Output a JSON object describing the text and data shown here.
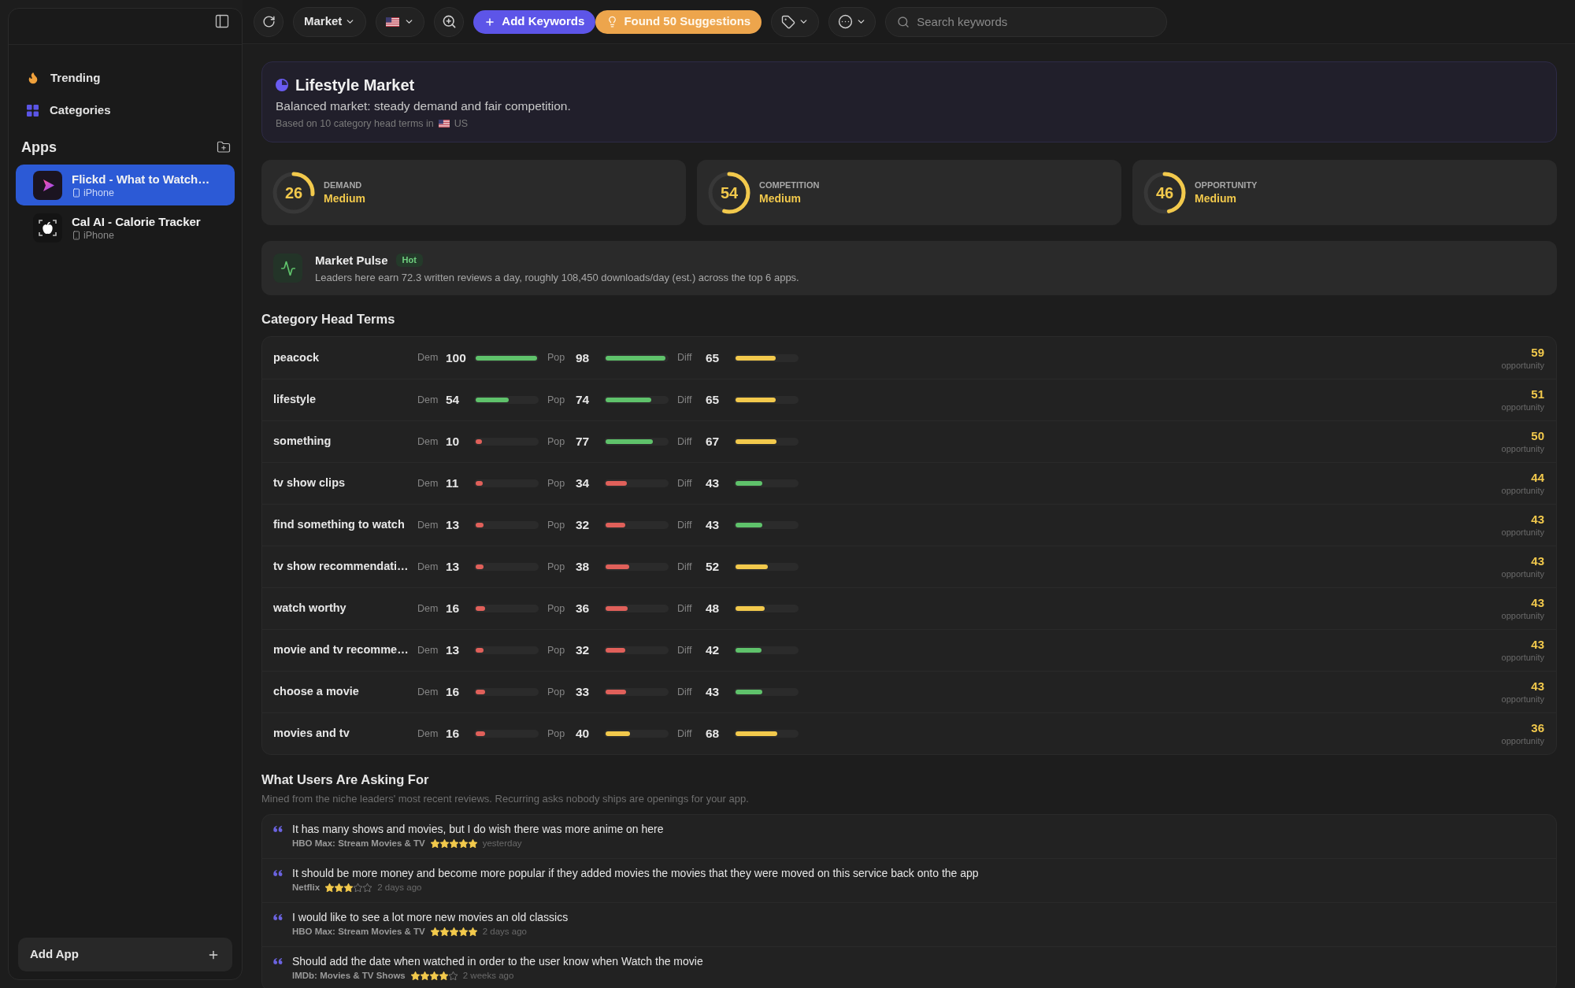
{
  "sidebar": {
    "nav": [
      {
        "label": "Trending"
      },
      {
        "label": "Categories"
      }
    ],
    "apps_heading": "Apps",
    "apps": [
      {
        "name": "Flickd - What to Watch…",
        "platform": "iPhone",
        "selected": true
      },
      {
        "name": "Cal AI - Calorie Tracker",
        "platform": "iPhone",
        "selected": false
      }
    ],
    "add_app": "Add App"
  },
  "toolbar": {
    "market_menu": "Market",
    "add_keywords": "Add Keywords",
    "suggestions": "Found 50 Suggestions",
    "search": {
      "placeholder": "Search keywords"
    }
  },
  "market": {
    "title": "Lifestyle Market",
    "summary": "Balanced market: steady demand and fair competition.",
    "basis": "Based on 10 category head terms in",
    "country": "US"
  },
  "metrics": [
    {
      "label": "DEMAND",
      "value": "26",
      "rating": "Medium",
      "level": 0.26
    },
    {
      "label": "COMPETITION",
      "value": "54",
      "rating": "Medium",
      "level": 0.54
    },
    {
      "label": "OPPORTUNITY",
      "value": "46",
      "rating": "Medium",
      "level": 0.46
    }
  ],
  "pulse": {
    "title": "Market Pulse",
    "badge": "Hot",
    "text": "Leaders here earn 72.3 written reviews a day, roughly 108,450 downloads/day (est.) across the top 6 apps."
  },
  "head_terms": {
    "title": "Category Head Terms",
    "rows": [
      {
        "term": "peacock",
        "scores": [
          {
            "label": "Dem",
            "value": "100",
            "level": 1.0,
            "color": "#5fc26b"
          },
          {
            "label": "Pop",
            "value": "98",
            "level": 0.98,
            "color": "#5fc26b"
          },
          {
            "label": "Diff",
            "value": "65",
            "level": 0.65,
            "color": "#f2c94c"
          }
        ],
        "opportunity": "59",
        "opportunity_label": "opportunity"
      },
      {
        "term": "lifestyle",
        "scores": [
          {
            "label": "Dem",
            "value": "54",
            "level": 0.54,
            "color": "#5fc26b"
          },
          {
            "label": "Pop",
            "value": "74",
            "level": 0.74,
            "color": "#5fc26b"
          },
          {
            "label": "Diff",
            "value": "65",
            "level": 0.65,
            "color": "#f2c94c"
          }
        ],
        "opportunity": "51",
        "opportunity_label": "opportunity"
      },
      {
        "term": "something",
        "scores": [
          {
            "label": "Dem",
            "value": "10",
            "level": 0.1,
            "color": "#e0605a"
          },
          {
            "label": "Pop",
            "value": "77",
            "level": 0.77,
            "color": "#5fc26b"
          },
          {
            "label": "Diff",
            "value": "67",
            "level": 0.67,
            "color": "#f2c94c"
          }
        ],
        "opportunity": "50",
        "opportunity_label": "opportunity"
      },
      {
        "term": "tv show clips",
        "scores": [
          {
            "label": "Dem",
            "value": "11",
            "level": 0.11,
            "color": "#e0605a"
          },
          {
            "label": "Pop",
            "value": "34",
            "level": 0.34,
            "color": "#e0605a"
          },
          {
            "label": "Diff",
            "value": "43",
            "level": 0.43,
            "color": "#5fc26b"
          }
        ],
        "opportunity": "44",
        "opportunity_label": "opportunity"
      },
      {
        "term": "find something to watch",
        "scores": [
          {
            "label": "Dem",
            "value": "13",
            "level": 0.13,
            "color": "#e0605a"
          },
          {
            "label": "Pop",
            "value": "32",
            "level": 0.32,
            "color": "#e0605a"
          },
          {
            "label": "Diff",
            "value": "43",
            "level": 0.43,
            "color": "#5fc26b"
          }
        ],
        "opportunity": "43",
        "opportunity_label": "opportunity"
      },
      {
        "term": "tv show recommendati…",
        "scores": [
          {
            "label": "Dem",
            "value": "13",
            "level": 0.13,
            "color": "#e0605a"
          },
          {
            "label": "Pop",
            "value": "38",
            "level": 0.38,
            "color": "#e0605a"
          },
          {
            "label": "Diff",
            "value": "52",
            "level": 0.52,
            "color": "#f2c94c"
          }
        ],
        "opportunity": "43",
        "opportunity_label": "opportunity"
      },
      {
        "term": "watch worthy",
        "scores": [
          {
            "label": "Dem",
            "value": "16",
            "level": 0.16,
            "color": "#e0605a"
          },
          {
            "label": "Pop",
            "value": "36",
            "level": 0.36,
            "color": "#e0605a"
          },
          {
            "label": "Diff",
            "value": "48",
            "level": 0.48,
            "color": "#f2c94c"
          }
        ],
        "opportunity": "43",
        "opportunity_label": "opportunity"
      },
      {
        "term": "movie and tv recomme…",
        "scores": [
          {
            "label": "Dem",
            "value": "13",
            "level": 0.13,
            "color": "#e0605a"
          },
          {
            "label": "Pop",
            "value": "32",
            "level": 0.32,
            "color": "#e0605a"
          },
          {
            "label": "Diff",
            "value": "42",
            "level": 0.42,
            "color": "#5fc26b"
          }
        ],
        "opportunity": "43",
        "opportunity_label": "opportunity"
      },
      {
        "term": "choose a movie",
        "scores": [
          {
            "label": "Dem",
            "value": "16",
            "level": 0.16,
            "color": "#e0605a"
          },
          {
            "label": "Pop",
            "value": "33",
            "level": 0.33,
            "color": "#e0605a"
          },
          {
            "label": "Diff",
            "value": "43",
            "level": 0.43,
            "color": "#5fc26b"
          }
        ],
        "opportunity": "43",
        "opportunity_label": "opportunity"
      },
      {
        "term": "movies and tv",
        "scores": [
          {
            "label": "Dem",
            "value": "16",
            "level": 0.16,
            "color": "#e0605a"
          },
          {
            "label": "Pop",
            "value": "40",
            "level": 0.4,
            "color": "#f2c94c"
          },
          {
            "label": "Diff",
            "value": "68",
            "level": 0.68,
            "color": "#f2c94c"
          }
        ],
        "opportunity": "36",
        "opportunity_label": "opportunity"
      }
    ]
  },
  "requests": {
    "title": "What Users Are Asking For",
    "subtitle": "Mined from the niche leaders' most recent reviews. Recurring asks nobody ships are openings for your app.",
    "reviews": [
      {
        "text": "It has many shows and movies, but I do wish there was more anime on here",
        "app": "HBO Max: Stream Movies & TV",
        "stars": 5,
        "when": "yesterday"
      },
      {
        "text": "It should be more money and become more popular if they added movies the movies that they were moved on this service back onto the app",
        "app": "Netflix",
        "stars": 3,
        "when": "2 days ago"
      },
      {
        "text": "I would like to see a lot more new movies an old classics",
        "app": "HBO Max: Stream Movies & TV",
        "stars": 5,
        "when": "2 days ago"
      },
      {
        "text": "Should add the date when watched in order to the user know when Watch the movie",
        "app": "IMDb: Movies & TV Shows",
        "stars": 4,
        "when": "2 weeks ago"
      }
    ]
  }
}
